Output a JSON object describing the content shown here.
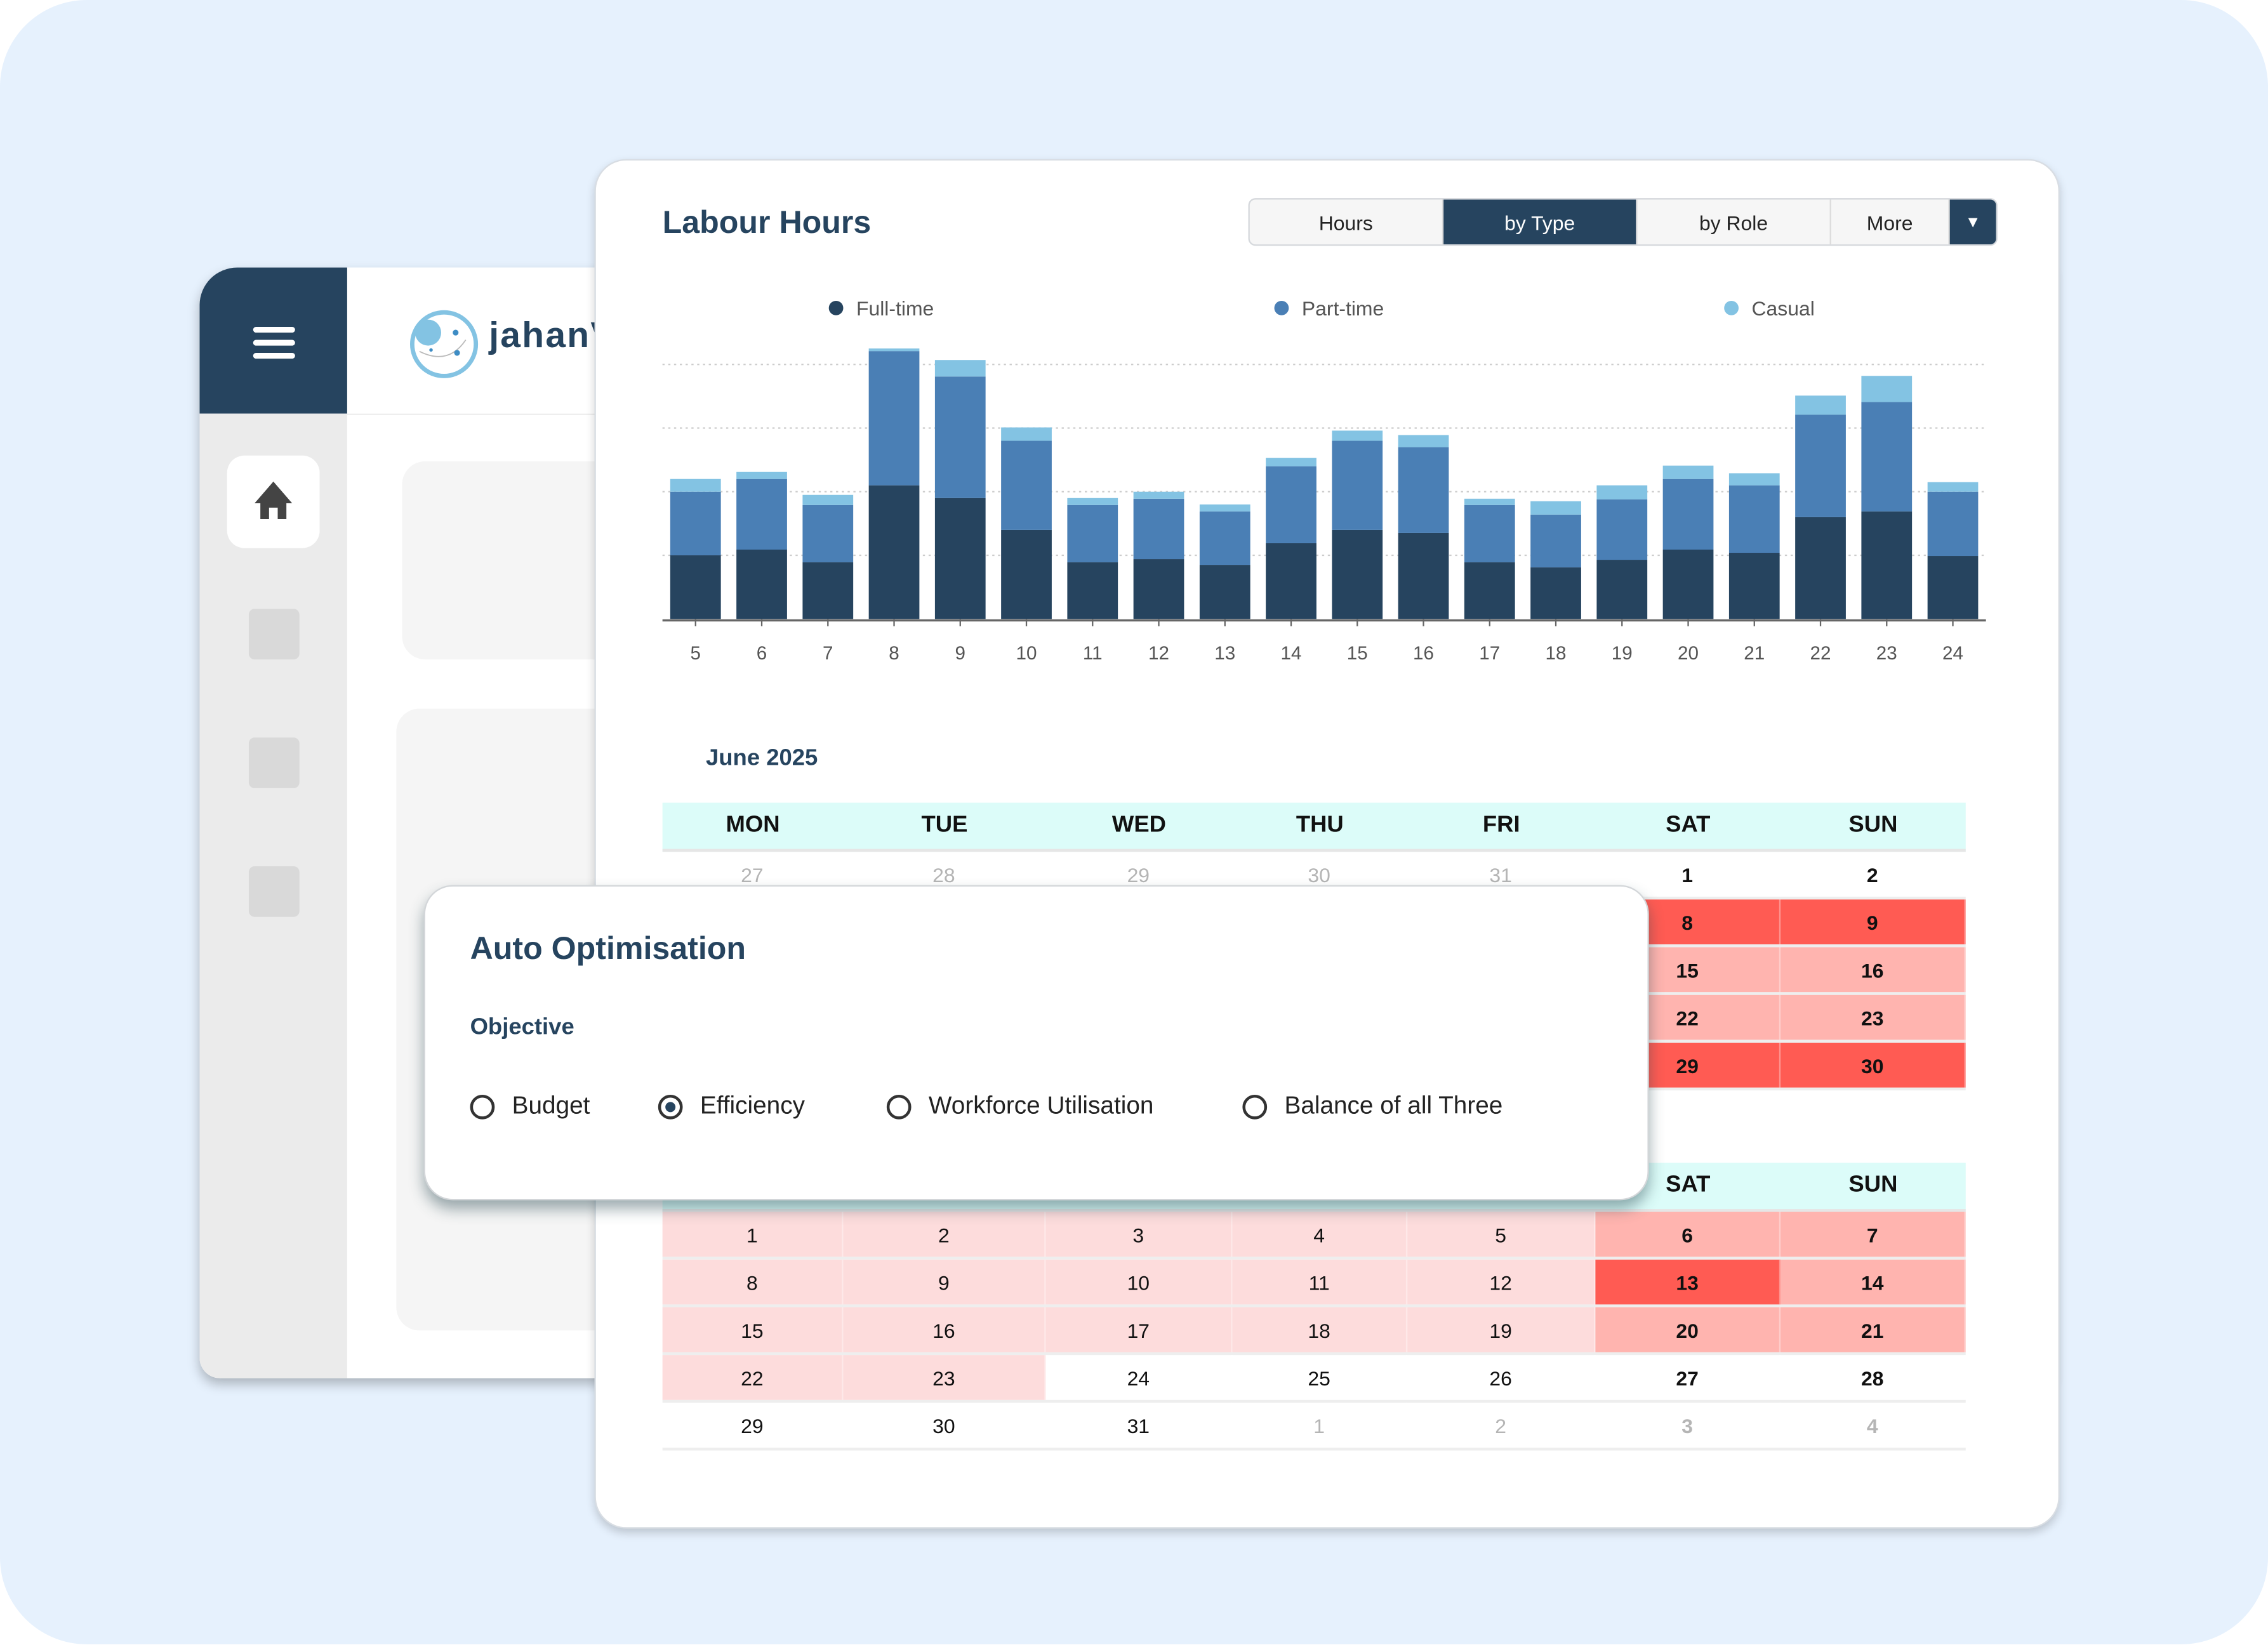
{
  "sidebar": {
    "menu_icon": "hamburger-icon",
    "items": [
      {
        "icon": "home-icon",
        "active": true
      },
      {
        "icon": "placeholder"
      },
      {
        "icon": "placeholder"
      },
      {
        "icon": "placeholder"
      }
    ]
  },
  "header": {
    "logo_text": "jahanV"
  },
  "labour_hours": {
    "title": "Labour Hours",
    "tabs": [
      {
        "label": "Hours",
        "active": false
      },
      {
        "label": "by Type",
        "active": true
      },
      {
        "label": "by Role",
        "active": false
      },
      {
        "label": "More",
        "active": false
      }
    ],
    "dropdown_icon": "caret-down-icon"
  },
  "colors": {
    "full_time": "#26445f",
    "part_time": "#4a7fb5",
    "casual": "#83c3e3",
    "accent": "#26445f",
    "heat_light": "#fddcdc",
    "heat_medium": "#ffb4af",
    "heat_strong": "#ff5b53",
    "calendar_header": "#dcfcf9"
  },
  "chart_data": {
    "type": "bar",
    "stacked": true,
    "categories": [
      "5",
      "6",
      "7",
      "8",
      "9",
      "10",
      "11",
      "12",
      "13",
      "14",
      "15",
      "16",
      "17",
      "18",
      "19",
      "20",
      "21",
      "22",
      "23",
      "24"
    ],
    "series": [
      {
        "name": "Full-time",
        "values": [
          10,
          10.9,
          8.9,
          21,
          19,
          14,
          8.9,
          9.4,
          8.5,
          11.9,
          14,
          13.5,
          8.9,
          8.1,
          9.3,
          10.9,
          10.4,
          16,
          16.9,
          9.9
        ]
      },
      {
        "name": "Part-time",
        "values": [
          10,
          11.1,
          9,
          21.1,
          19.1,
          14,
          9,
          9.5,
          8.4,
          12.1,
          14,
          13.5,
          9,
          8.3,
          9.5,
          11.1,
          10.6,
          16.1,
          17.2,
          10.1
        ]
      },
      {
        "name": "Casual",
        "values": [
          2,
          1.1,
          1.6,
          3.1,
          2.6,
          2.1,
          1.1,
          1.1,
          1.1,
          1.3,
          1.6,
          1.9,
          1,
          2.1,
          2.2,
          2.1,
          1.9,
          3,
          4.1,
          1.5
        ]
      }
    ],
    "ylim": [
      0,
      45
    ],
    "grid": true,
    "legend": "top"
  },
  "calendar": {
    "weekdays": [
      "MON",
      "TUE",
      "WED",
      "THU",
      "FRI",
      "SAT",
      "SUN"
    ],
    "months": [
      {
        "title": "June 2025",
        "weeks": [
          [
            {
              "d": "27",
              "m": true
            },
            {
              "d": "28",
              "m": true
            },
            {
              "d": "29",
              "m": true
            },
            {
              "d": "30",
              "m": true
            },
            {
              "d": "31",
              "m": true
            },
            {
              "d": "1",
              "l": 0
            },
            {
              "d": "2",
              "l": 0
            }
          ],
          [
            {
              "d": "",
              "l": 1
            },
            {
              "d": "",
              "l": 1
            },
            {
              "d": "",
              "l": 1
            },
            {
              "d": "",
              "l": 1
            },
            {
              "d": "",
              "l": 1
            },
            {
              "d": "8",
              "l": 3
            },
            {
              "d": "9",
              "l": 3
            }
          ],
          [
            {
              "d": "",
              "l": 1
            },
            {
              "d": "",
              "l": 1
            },
            {
              "d": "",
              "l": 1
            },
            {
              "d": "",
              "l": 1
            },
            {
              "d": "",
              "l": 1
            },
            {
              "d": "15",
              "l": 2
            },
            {
              "d": "16",
              "l": 2
            }
          ],
          [
            {
              "d": "",
              "l": 1
            },
            {
              "d": "",
              "l": 1
            },
            {
              "d": "",
              "l": 1
            },
            {
              "d": "",
              "l": 1
            },
            {
              "d": "",
              "l": 1
            },
            {
              "d": "22",
              "l": 2
            },
            {
              "d": "23",
              "l": 2
            }
          ],
          [
            {
              "d": "",
              "l": 1
            },
            {
              "d": "",
              "l": 1
            },
            {
              "d": "",
              "l": 1
            },
            {
              "d": "",
              "l": 1
            },
            {
              "d": "",
              "l": 1
            },
            {
              "d": "29",
              "l": 3
            },
            {
              "d": "30",
              "l": 3
            }
          ]
        ]
      },
      {
        "title": "",
        "weeks": [
          [
            {
              "d": "1",
              "l": 1
            },
            {
              "d": "2",
              "l": 1
            },
            {
              "d": "3",
              "l": 1
            },
            {
              "d": "4",
              "l": 1
            },
            {
              "d": "5",
              "l": 1
            },
            {
              "d": "6",
              "l": 2
            },
            {
              "d": "7",
              "l": 2
            }
          ],
          [
            {
              "d": "8",
              "l": 1
            },
            {
              "d": "9",
              "l": 1
            },
            {
              "d": "10",
              "l": 1
            },
            {
              "d": "11",
              "l": 1
            },
            {
              "d": "12",
              "l": 1
            },
            {
              "d": "13",
              "l": 3
            },
            {
              "d": "14",
              "l": 2
            }
          ],
          [
            {
              "d": "15",
              "l": 1
            },
            {
              "d": "16",
              "l": 1
            },
            {
              "d": "17",
              "l": 1
            },
            {
              "d": "18",
              "l": 1
            },
            {
              "d": "19",
              "l": 1
            },
            {
              "d": "20",
              "l": 2
            },
            {
              "d": "21",
              "l": 2
            }
          ],
          [
            {
              "d": "22",
              "l": 1
            },
            {
              "d": "23",
              "l": 1
            },
            {
              "d": "24",
              "l": 0
            },
            {
              "d": "25",
              "l": 0
            },
            {
              "d": "26",
              "l": 0
            },
            {
              "d": "27",
              "l": 0
            },
            {
              "d": "28",
              "l": 0
            }
          ],
          [
            {
              "d": "29",
              "l": 0
            },
            {
              "d": "30",
              "l": 0
            },
            {
              "d": "31",
              "l": 0
            },
            {
              "d": "1",
              "m": true
            },
            {
              "d": "2",
              "m": true
            },
            {
              "d": "3",
              "m": true
            },
            {
              "d": "4",
              "m": true
            }
          ]
        ]
      }
    ]
  },
  "auto_optimisation": {
    "title": "Auto Optimisation",
    "objective_label": "Objective",
    "options": [
      {
        "label": "Budget",
        "selected": false
      },
      {
        "label": "Efficiency",
        "selected": true
      },
      {
        "label": "Workforce Utilisation",
        "selected": false
      },
      {
        "label": "Balance of all Three",
        "selected": false
      }
    ]
  }
}
